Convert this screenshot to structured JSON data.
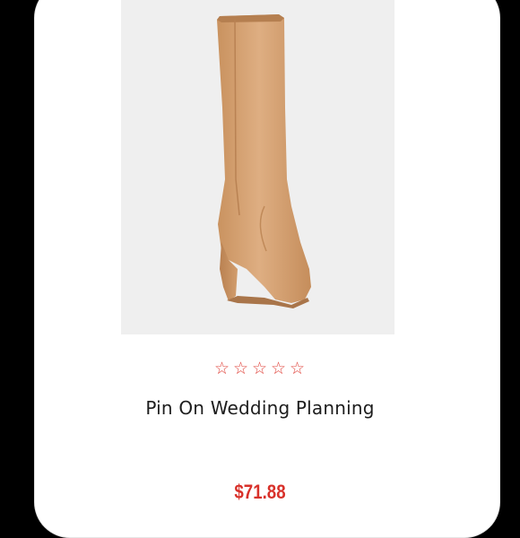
{
  "product": {
    "image_icon": "knee-high-wedge-boot-image",
    "rating_stars": 0,
    "rating_max": 5,
    "star_glyph": "☆",
    "title": "Pin On Wedding Planning",
    "price": "$71.88"
  },
  "colors": {
    "background": "#000000",
    "card": "#ffffff",
    "image_bg": "#efefef",
    "accent": "#e0443c",
    "price": "#d8312a",
    "boot": "#d9a77a"
  }
}
